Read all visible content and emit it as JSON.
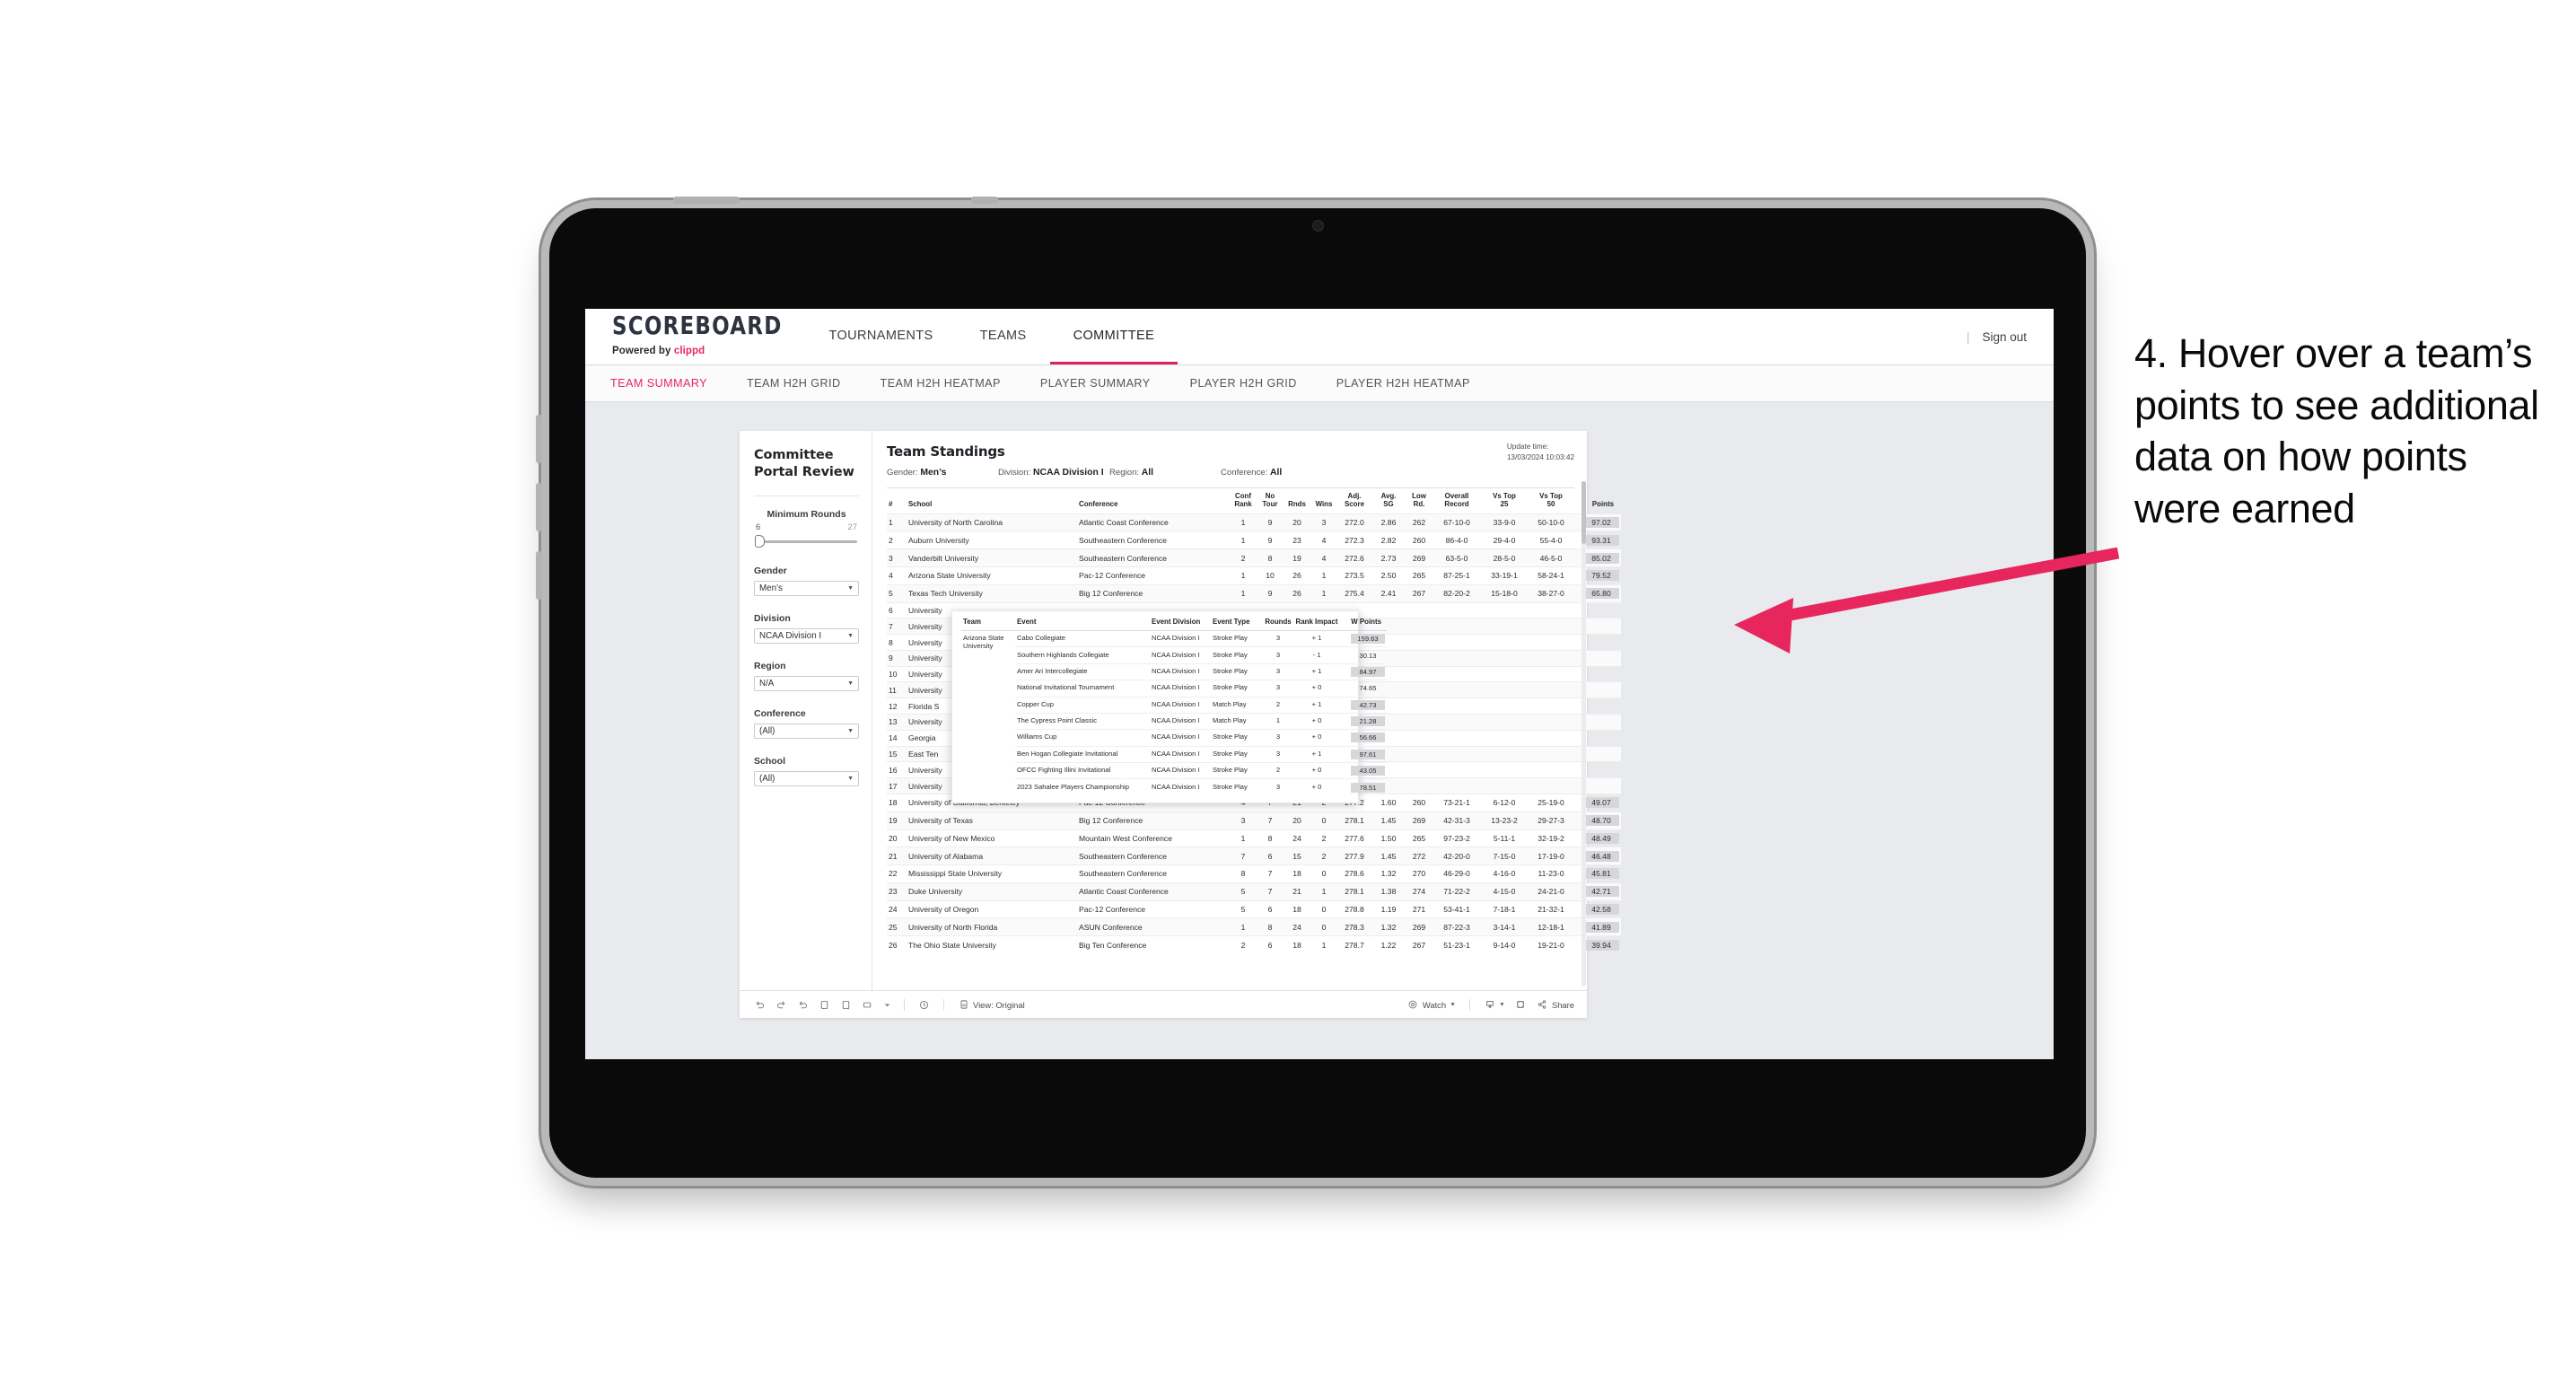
{
  "app": {
    "brand_title": "SCOREBOARD",
    "brand_sub_prefix": "Powered by ",
    "brand_sub_name": "clippd",
    "nav_tabs": [
      {
        "label": "TOURNAMENTS",
        "active": false
      },
      {
        "label": "TEAMS",
        "active": false
      },
      {
        "label": "COMMITTEE",
        "active": true
      }
    ],
    "sign_out": "Sign out",
    "sub_tabs": [
      {
        "label": "TEAM SUMMARY",
        "active": true
      },
      {
        "label": "TEAM H2H GRID",
        "active": false
      },
      {
        "label": "TEAM H2H HEATMAP",
        "active": false
      },
      {
        "label": "PLAYER SUMMARY",
        "active": false
      },
      {
        "label": "PLAYER H2H GRID",
        "active": false
      },
      {
        "label": "PLAYER H2H HEATMAP",
        "active": false
      }
    ],
    "accent": "#e8265e"
  },
  "filters": {
    "panel_title": "Committee Portal Review",
    "min_rounds": {
      "label": "Minimum Rounds",
      "min": "6",
      "max": "27"
    },
    "gender": {
      "label": "Gender",
      "value": "Men’s"
    },
    "division": {
      "label": "Division",
      "value": "NCAA Division I"
    },
    "region": {
      "label": "Region",
      "value": "N/A"
    },
    "conference": {
      "label": "Conference",
      "value": "(All)"
    },
    "school": {
      "label": "School",
      "value": "(All)"
    }
  },
  "report": {
    "title": "Team Standings",
    "update_label": "Update time:",
    "update_value": "13/03/2024 10:03:42",
    "crumbs": [
      {
        "label": "Gender:",
        "value": "Men’s"
      },
      {
        "label": "Division:",
        "value": "NCAA Division I"
      },
      {
        "label": "Region:",
        "value": "All"
      },
      {
        "label": "Conference:",
        "value": "All"
      }
    ]
  },
  "standings": {
    "columns": [
      "#",
      "School",
      "Conference",
      "Conf Rank",
      "No Tour",
      "Rnds",
      "Wins",
      "Adj. Score",
      "Avg. SG",
      "Low Rd.",
      "Overall Record",
      "Vs Top 25",
      "Vs Top 50",
      "Points"
    ],
    "columns_split": [
      [
        "#",
        ""
      ],
      [
        "School",
        ""
      ],
      [
        "Conference",
        ""
      ],
      [
        "Conf",
        "Rank"
      ],
      [
        "No",
        "Tour"
      ],
      [
        "Rnds",
        ""
      ],
      [
        "Wins",
        ""
      ],
      [
        "Adj.",
        "Score"
      ],
      [
        "Avg.",
        "SG"
      ],
      [
        "Low",
        "Rd."
      ],
      [
        "Overall",
        "Record"
      ],
      [
        "Vs Top",
        "25"
      ],
      [
        "Vs Top",
        "50"
      ],
      [
        "Points",
        ""
      ]
    ],
    "rows": [
      {
        "rank": "1",
        "school": "University of North Carolina",
        "conf": "Atlantic Coast Conference",
        "conf_rank": "1",
        "no_tour": "9",
        "rnds": "20",
        "wins": "3",
        "adj_score": "272.0",
        "avg_sg": "2.86",
        "low_rd": "262",
        "record": "67-10-0",
        "vs25": "33-9-0",
        "vs50": "50-10-0",
        "points": "97.02",
        "hidden": false
      },
      {
        "rank": "2",
        "school": "Auburn University",
        "conf": "Southeastern Conference",
        "conf_rank": "1",
        "no_tour": "9",
        "rnds": "23",
        "wins": "4",
        "adj_score": "272.3",
        "avg_sg": "2.82",
        "low_rd": "260",
        "record": "86-4-0",
        "vs25": "29-4-0",
        "vs50": "55-4-0",
        "points": "93.31",
        "hidden": false
      },
      {
        "rank": "3",
        "school": "Vanderbilt University",
        "conf": "Southeastern Conference",
        "conf_rank": "2",
        "no_tour": "8",
        "rnds": "19",
        "wins": "4",
        "adj_score": "272.6",
        "avg_sg": "2.73",
        "low_rd": "269",
        "record": "63-5-0",
        "vs25": "28-5-0",
        "vs50": "46-5-0",
        "points": "85.02",
        "hidden": false
      },
      {
        "rank": "4",
        "school": "Arizona State University",
        "conf": "Pac-12 Conference",
        "conf_rank": "1",
        "no_tour": "10",
        "rnds": "26",
        "wins": "1",
        "adj_score": "273.5",
        "avg_sg": "2.50",
        "low_rd": "265",
        "record": "87-25-1",
        "vs25": "33-19-1",
        "vs50": "58-24-1",
        "points": "79.52",
        "hidden": false
      },
      {
        "rank": "5",
        "school": "Texas Tech University",
        "conf": "Big 12 Conference",
        "conf_rank": "1",
        "no_tour": "9",
        "rnds": "26",
        "wins": "1",
        "adj_score": "275.4",
        "avg_sg": "2.41",
        "low_rd": "267",
        "record": "82-20-2",
        "vs25": "15-18-0",
        "vs50": "38-27-0",
        "points": "65.80",
        "hidden": true
      },
      {
        "rank": "6",
        "school": "University",
        "conf": "",
        "conf_rank": "",
        "no_tour": "",
        "rnds": "",
        "wins": "",
        "adj_score": "",
        "avg_sg": "",
        "low_rd": "",
        "record": "",
        "vs25": "",
        "vs50": "",
        "points": "",
        "hidden": true
      },
      {
        "rank": "7",
        "school": "University",
        "conf": "",
        "conf_rank": "",
        "no_tour": "",
        "rnds": "",
        "wins": "",
        "adj_score": "",
        "avg_sg": "",
        "low_rd": "",
        "record": "",
        "vs25": "",
        "vs50": "",
        "points": "",
        "hidden": true
      },
      {
        "rank": "8",
        "school": "University",
        "conf": "",
        "conf_rank": "",
        "no_tour": "",
        "rnds": "",
        "wins": "",
        "adj_score": "",
        "avg_sg": "",
        "low_rd": "",
        "record": "",
        "vs25": "",
        "vs50": "",
        "points": "",
        "hidden": true
      },
      {
        "rank": "9",
        "school": "University",
        "conf": "",
        "conf_rank": "",
        "no_tour": "",
        "rnds": "",
        "wins": "",
        "adj_score": "",
        "avg_sg": "",
        "low_rd": "",
        "record": "",
        "vs25": "",
        "vs50": "",
        "points": "",
        "hidden": true
      },
      {
        "rank": "10",
        "school": "University",
        "conf": "",
        "conf_rank": "",
        "no_tour": "",
        "rnds": "",
        "wins": "",
        "adj_score": "",
        "avg_sg": "",
        "low_rd": "",
        "record": "",
        "vs25": "",
        "vs50": "",
        "points": "",
        "hidden": true
      },
      {
        "rank": "11",
        "school": "University",
        "conf": "",
        "conf_rank": "",
        "no_tour": "",
        "rnds": "",
        "wins": "",
        "adj_score": "",
        "avg_sg": "",
        "low_rd": "",
        "record": "",
        "vs25": "",
        "vs50": "",
        "points": "",
        "hidden": true
      },
      {
        "rank": "12",
        "school": "Florida S",
        "conf": "",
        "conf_rank": "",
        "no_tour": "",
        "rnds": "",
        "wins": "",
        "adj_score": "",
        "avg_sg": "",
        "low_rd": "",
        "record": "",
        "vs25": "",
        "vs50": "",
        "points": "",
        "hidden": true
      },
      {
        "rank": "13",
        "school": "University",
        "conf": "",
        "conf_rank": "",
        "no_tour": "",
        "rnds": "",
        "wins": "",
        "adj_score": "",
        "avg_sg": "",
        "low_rd": "",
        "record": "",
        "vs25": "",
        "vs50": "",
        "points": "",
        "hidden": true
      },
      {
        "rank": "14",
        "school": "Georgia",
        "conf": "",
        "conf_rank": "",
        "no_tour": "",
        "rnds": "",
        "wins": "",
        "adj_score": "",
        "avg_sg": "",
        "low_rd": "",
        "record": "",
        "vs25": "",
        "vs50": "",
        "points": "",
        "hidden": true
      },
      {
        "rank": "15",
        "school": "East Ten",
        "conf": "",
        "conf_rank": "",
        "no_tour": "",
        "rnds": "",
        "wins": "",
        "adj_score": "",
        "avg_sg": "",
        "low_rd": "",
        "record": "",
        "vs25": "",
        "vs50": "",
        "points": "",
        "hidden": true
      },
      {
        "rank": "16",
        "school": "University",
        "conf": "",
        "conf_rank": "",
        "no_tour": "",
        "rnds": "",
        "wins": "",
        "adj_score": "",
        "avg_sg": "",
        "low_rd": "",
        "record": "",
        "vs25": "",
        "vs50": "",
        "points": "",
        "hidden": true
      },
      {
        "rank": "17",
        "school": "University",
        "conf": "",
        "conf_rank": "",
        "no_tour": "",
        "rnds": "",
        "wins": "",
        "adj_score": "",
        "avg_sg": "",
        "low_rd": "",
        "record": "",
        "vs25": "",
        "vs50": "",
        "points": "",
        "hidden": true
      },
      {
        "rank": "18",
        "school": "University of California, Berkeley",
        "conf": "Pac-12 Conference",
        "conf_rank": "4",
        "no_tour": "7",
        "rnds": "21",
        "wins": "2",
        "adj_score": "277.2",
        "avg_sg": "1.60",
        "low_rd": "260",
        "record": "73-21-1",
        "vs25": "6-12-0",
        "vs50": "25-19-0",
        "points": "49.07",
        "hidden": false
      },
      {
        "rank": "19",
        "school": "University of Texas",
        "conf": "Big 12 Conference",
        "conf_rank": "3",
        "no_tour": "7",
        "rnds": "20",
        "wins": "0",
        "adj_score": "278.1",
        "avg_sg": "1.45",
        "low_rd": "269",
        "record": "42-31-3",
        "vs25": "13-23-2",
        "vs50": "29-27-3",
        "points": "48.70",
        "hidden": false
      },
      {
        "rank": "20",
        "school": "University of New Mexico",
        "conf": "Mountain West Conference",
        "conf_rank": "1",
        "no_tour": "8",
        "rnds": "24",
        "wins": "2",
        "adj_score": "277.6",
        "avg_sg": "1.50",
        "low_rd": "265",
        "record": "97-23-2",
        "vs25": "5-11-1",
        "vs50": "32-19-2",
        "points": "48.49",
        "hidden": false
      },
      {
        "rank": "21",
        "school": "University of Alabama",
        "conf": "Southeastern Conference",
        "conf_rank": "7",
        "no_tour": "6",
        "rnds": "15",
        "wins": "2",
        "adj_score": "277.9",
        "avg_sg": "1.45",
        "low_rd": "272",
        "record": "42-20-0",
        "vs25": "7-15-0",
        "vs50": "17-19-0",
        "points": "46.48",
        "hidden": false
      },
      {
        "rank": "22",
        "school": "Mississippi State University",
        "conf": "Southeastern Conference",
        "conf_rank": "8",
        "no_tour": "7",
        "rnds": "18",
        "wins": "0",
        "adj_score": "278.6",
        "avg_sg": "1.32",
        "low_rd": "270",
        "record": "46-29-0",
        "vs25": "4-16-0",
        "vs50": "11-23-0",
        "points": "45.81",
        "hidden": false
      },
      {
        "rank": "23",
        "school": "Duke University",
        "conf": "Atlantic Coast Conference",
        "conf_rank": "5",
        "no_tour": "7",
        "rnds": "21",
        "wins": "1",
        "adj_score": "278.1",
        "avg_sg": "1.38",
        "low_rd": "274",
        "record": "71-22-2",
        "vs25": "4-15-0",
        "vs50": "24-21-0",
        "points": "42.71",
        "hidden": false
      },
      {
        "rank": "24",
        "school": "University of Oregon",
        "conf": "Pac-12 Conference",
        "conf_rank": "5",
        "no_tour": "6",
        "rnds": "18",
        "wins": "0",
        "adj_score": "278.8",
        "avg_sg": "1.19",
        "low_rd": "271",
        "record": "53-41-1",
        "vs25": "7-18-1",
        "vs50": "21-32-1",
        "points": "42.58",
        "hidden": false
      },
      {
        "rank": "25",
        "school": "University of North Florida",
        "conf": "ASUN Conference",
        "conf_rank": "1",
        "no_tour": "8",
        "rnds": "24",
        "wins": "0",
        "adj_score": "278.3",
        "avg_sg": "1.32",
        "low_rd": "269",
        "record": "87-22-3",
        "vs25": "3-14-1",
        "vs50": "12-18-1",
        "points": "41.89",
        "hidden": false
      },
      {
        "rank": "26",
        "school": "The Ohio State University",
        "conf": "Big Ten Conference",
        "conf_rank": "2",
        "no_tour": "6",
        "rnds": "18",
        "wins": "1",
        "adj_score": "278.7",
        "avg_sg": "1.22",
        "low_rd": "267",
        "record": "51-23-1",
        "vs25": "9-14-0",
        "vs50": "19-21-0",
        "points": "39.94",
        "hidden": false
      }
    ]
  },
  "tooltip": {
    "columns": [
      "Team",
      "Event",
      "Event Division",
      "Event Type",
      "Rounds",
      "Rank Impact",
      "W Points"
    ],
    "team": "Arizona State University",
    "rows": [
      {
        "event": "Cabo Collegiate",
        "division": "NCAA Division I",
        "type": "Stroke Play",
        "rounds": "3",
        "impact": "+ 1",
        "wpoints": "159.63",
        "highlight": true
      },
      {
        "event": "Southern Highlands Collegiate",
        "division": "NCAA Division I",
        "type": "Stroke Play",
        "rounds": "3",
        "impact": "- 1",
        "wpoints": "30.13",
        "highlight": false
      },
      {
        "event": "Amer Ari Intercollegiate",
        "division": "NCAA Division I",
        "type": "Stroke Play",
        "rounds": "3",
        "impact": "+ 1",
        "wpoints": "84.97",
        "highlight": true
      },
      {
        "event": "National Invitational Tournament",
        "division": "NCAA Division I",
        "type": "Stroke Play",
        "rounds": "3",
        "impact": "+ 0",
        "wpoints": "74.65",
        "highlight": false
      },
      {
        "event": "Copper Cup",
        "division": "NCAA Division I",
        "type": "Match Play",
        "rounds": "2",
        "impact": "+ 1",
        "wpoints": "42.73",
        "highlight": true
      },
      {
        "event": "The Cypress Point Classic",
        "division": "NCAA Division I",
        "type": "Match Play",
        "rounds": "1",
        "impact": "+ 0",
        "wpoints": "21.28",
        "highlight": true
      },
      {
        "event": "Williams Cup",
        "division": "NCAA Division I",
        "type": "Stroke Play",
        "rounds": "3",
        "impact": "+ 0",
        "wpoints": "56.66",
        "highlight": true
      },
      {
        "event": "Ben Hogan Collegiate Invitational",
        "division": "NCAA Division I",
        "type": "Stroke Play",
        "rounds": "3",
        "impact": "+ 1",
        "wpoints": "97.61",
        "highlight": true
      },
      {
        "event": "OFCC Fighting Illini Invitational",
        "division": "NCAA Division I",
        "type": "Stroke Play",
        "rounds": "2",
        "impact": "+ 0",
        "wpoints": "43.05",
        "highlight": true
      },
      {
        "event": "2023 Sahalee Players Championship",
        "division": "NCAA Division I",
        "type": "Stroke Play",
        "rounds": "3",
        "impact": "+ 0",
        "wpoints": "78.51",
        "highlight": true
      }
    ]
  },
  "toolbar": {
    "view_label": "View: Original",
    "watch_label": "Watch",
    "share_label": "Share"
  },
  "annotation": {
    "text": "4. Hover over a team’s points to see additional data on how points were earned",
    "arrow_color": "#e8265e"
  }
}
